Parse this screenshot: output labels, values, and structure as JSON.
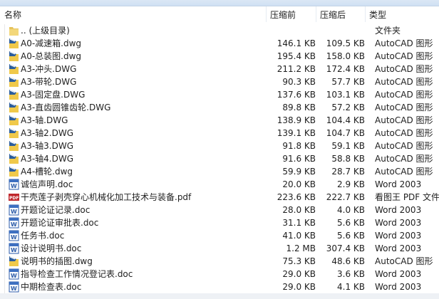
{
  "columns": {
    "name": "名称",
    "before": "压缩前",
    "after": "压缩后",
    "type": "类型"
  },
  "rows": [
    {
      "icon": "folder",
      "name": ".. (上级目录)",
      "before": "",
      "after": "",
      "type": "文件夹"
    },
    {
      "icon": "dwg",
      "name": "A0-减速箱.dwg",
      "before": "146.1 KB",
      "after": "109.5 KB",
      "type": "AutoCAD 图形"
    },
    {
      "icon": "dwg",
      "name": "A0-总装图.dwg",
      "before": "195.4 KB",
      "after": "158.0 KB",
      "type": "AutoCAD 图形"
    },
    {
      "icon": "dwg",
      "name": "A3-冲头.DWG",
      "before": "211.2 KB",
      "after": "172.4 KB",
      "type": "AutoCAD 图形"
    },
    {
      "icon": "dwg",
      "name": "A3-带轮.DWG",
      "before": "90.3 KB",
      "after": "57.7 KB",
      "type": "AutoCAD 图形"
    },
    {
      "icon": "dwg",
      "name": "A3-固定盘.DWG",
      "before": "137.6 KB",
      "after": "103.1 KB",
      "type": "AutoCAD 图形"
    },
    {
      "icon": "dwg",
      "name": "A3-直齿圆锥齿轮.DWG",
      "before": "89.8 KB",
      "after": "57.2 KB",
      "type": "AutoCAD 图形"
    },
    {
      "icon": "dwg",
      "name": "A3-轴.DWG",
      "before": "138.9 KB",
      "after": "104.4 KB",
      "type": "AutoCAD 图形"
    },
    {
      "icon": "dwg",
      "name": "A3-轴2.DWG",
      "before": "139.1 KB",
      "after": "104.7 KB",
      "type": "AutoCAD 图形"
    },
    {
      "icon": "dwg",
      "name": "A3-轴3.DWG",
      "before": "91.8 KB",
      "after": "59.1 KB",
      "type": "AutoCAD 图形"
    },
    {
      "icon": "dwg",
      "name": "A3-轴4.DWG",
      "before": "91.6 KB",
      "after": "58.8 KB",
      "type": "AutoCAD 图形"
    },
    {
      "icon": "dwg",
      "name": "A4-槽轮.dwg",
      "before": "59.9 KB",
      "after": "28.7 KB",
      "type": "AutoCAD 图形"
    },
    {
      "icon": "doc",
      "name": "诚信声明.doc",
      "before": "20.0 KB",
      "after": "2.9 KB",
      "type": "Word 2003"
    },
    {
      "icon": "pdf",
      "name": "干壳莲子剥壳穿心机械化加工技术与装备.pdf",
      "before": "223.6 KB",
      "after": "222.7 KB",
      "type": "看图王 PDF 文件"
    },
    {
      "icon": "doc",
      "name": "开题论证记录.doc",
      "before": "28.0 KB",
      "after": "4.0 KB",
      "type": "Word 2003"
    },
    {
      "icon": "doc",
      "name": "开题论证审批表.doc",
      "before": "31.1 KB",
      "after": "5.6 KB",
      "type": "Word 2003"
    },
    {
      "icon": "doc",
      "name": "任务书.doc",
      "before": "41.0 KB",
      "after": "5.6 KB",
      "type": "Word 2003"
    },
    {
      "icon": "doc",
      "name": "设计说明书.doc",
      "before": "1.2 MB",
      "after": "307.4 KB",
      "type": "Word 2003"
    },
    {
      "icon": "dwg",
      "name": "说明书的插图.dwg",
      "before": "75.3 KB",
      "after": "48.6 KB",
      "type": "AutoCAD 图形"
    },
    {
      "icon": "doc",
      "name": "指导检查工作情况登记表.doc",
      "before": "29.0 KB",
      "after": "3.6 KB",
      "type": "Word 2003"
    },
    {
      "icon": "doc",
      "name": "中期检查表.doc",
      "before": "29.0 KB",
      "after": "4.1 KB",
      "type": "Word 2003"
    }
  ]
}
